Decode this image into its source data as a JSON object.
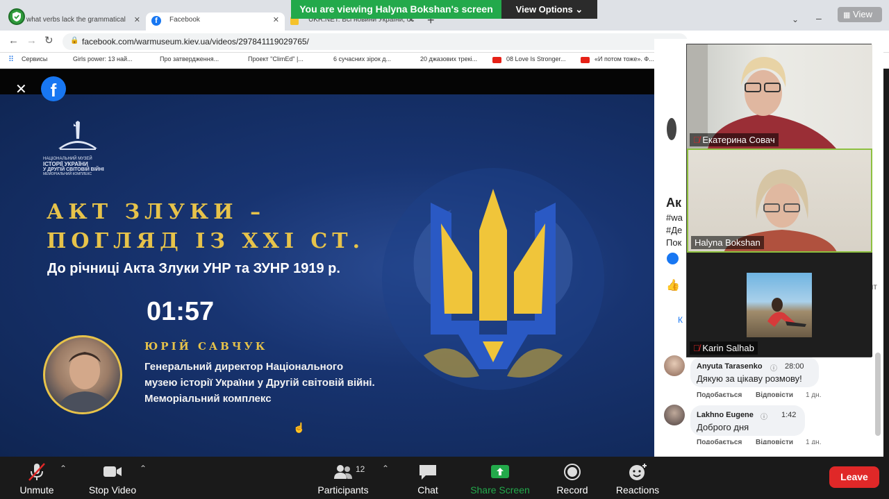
{
  "banner": {
    "viewing": "You are viewing Halyna Bokshan's screen",
    "view_options": "View Options",
    "view_right": "View"
  },
  "tabs": [
    {
      "label": "what verbs lack the grammatical",
      "active": false
    },
    {
      "label": "Facebook",
      "active": true
    },
    {
      "label": "UKR.NET: Всі новини України, ос",
      "active": false
    }
  ],
  "address": {
    "url": "facebook.com/warmuseum.kiev.ua/videos/297841119029765/"
  },
  "bookmarks": [
    "Сервисы",
    "Girls power: 13 най...",
    "Про затвердження...",
    "Проект \"ClimEd\" |...",
    "6 сучасних зірок д...",
    "20 джазових трекі...",
    "08 Love Is Stronger...",
    "«И потом тоже». Ф..."
  ],
  "video": {
    "logo_text": [
      "НАЦІОНАЛЬНИЙ МУЗЕЙ",
      "ІСТОРІЇ УКРАЇНИ",
      "У ДРУГІЙ СВІТОВІЙ ВІЙНІ",
      "МЕМОРІАЛЬНИЙ КОМПЛЕКС"
    ],
    "title1": "АКТ ЗЛУКИ –",
    "title2": "ПОГЛЯД ІЗ XXI СТ.",
    "subtitle": "До річниці Акта Злуки УНР та ЗУНР 1919 р.",
    "time": "01:57",
    "speaker": "ЮРІЙ САВЧУК",
    "position": [
      "Генеральний директор Національного",
      "музею історії України у Другій світовій війні.",
      "Меморіальний комплекс"
    ]
  },
  "fb": {
    "partial": [
      "Ак",
      "#wa",
      "#Де",
      "Пок",
      "в",
      "рит",
      "К",
      "и"
    ],
    "comments": [
      {
        "name": "Anyuta Tarasenko",
        "time": "28:00",
        "text": "Дякую за цікаву розмову!",
        "like": "Подобається",
        "reply": "Відповісти",
        "age": "1 дн."
      },
      {
        "name": "Lakhno Eugene",
        "time": "1:42",
        "text": "Доброго дня",
        "like": "Подобається",
        "reply": "Відповісти",
        "age": "1 дн."
      }
    ]
  },
  "gallery": [
    {
      "name": "Екатерина Совач",
      "muted": true
    },
    {
      "name": "Halyna Bokshan",
      "muted": false
    },
    {
      "name": "Karin Salhab",
      "muted": true
    }
  ],
  "controls": {
    "unmute": "Unmute",
    "stop_video": "Stop Video",
    "participants": "Participants",
    "participants_count": "12",
    "chat": "Chat",
    "share_screen": "Share Screen",
    "record": "Record",
    "reactions": "Reactions",
    "leave": "Leave"
  },
  "colors": {
    "zoom_green": "#23a94b",
    "leave_red": "#e02828",
    "gold": "#e7c34a",
    "fb_blue": "#1877f2"
  }
}
